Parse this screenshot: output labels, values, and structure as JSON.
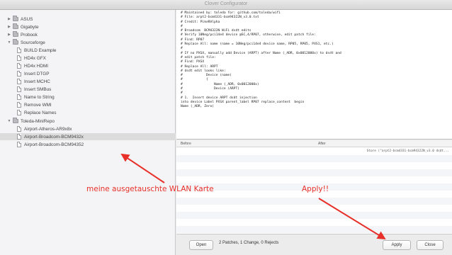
{
  "window": {
    "title": "Clover Configurator"
  },
  "sidebar": {
    "items": [
      {
        "label": "ASUS",
        "type": "folder",
        "expanded": false
      },
      {
        "label": "Gigabyte",
        "type": "folder",
        "expanded": false
      },
      {
        "label": "Probook",
        "type": "folder",
        "expanded": false
      },
      {
        "label": "Sourceforge",
        "type": "folder",
        "expanded": true
      },
      {
        "label": "BUILD Example",
        "type": "file"
      },
      {
        "label": "HD4x GFX",
        "type": "file"
      },
      {
        "label": "HD4x HDMI",
        "type": "file"
      },
      {
        "label": "Insert DTGP",
        "type": "file"
      },
      {
        "label": "Insert MCHC",
        "type": "file"
      },
      {
        "label": "Insert SMBus",
        "type": "file"
      },
      {
        "label": "Name to String",
        "type": "file"
      },
      {
        "label": "Remove WMI",
        "type": "file"
      },
      {
        "label": "Replace Names",
        "type": "file"
      },
      {
        "label": "Toleda-MiniRepo",
        "type": "folder",
        "expanded": true
      },
      {
        "label": "Airport-Atheros-AR9x8x",
        "type": "file"
      },
      {
        "label": "Airport-Broadcom-BCM9432x",
        "type": "file",
        "selected": true
      },
      {
        "label": "Airport-Broadcom-BCM94352",
        "type": "file"
      }
    ]
  },
  "code": {
    "lines": [
      "# Maintained by: toleda for: github.com/toleda/wifi",
      "# File: arpt2-bcm4331-bcm94322N_v3.0.txt",
      "# Credit: PikeRAlpha",
      "#",
      "# Broadcom  BCM4322N WiFi dsdt edits",
      "# Verify 10Neg/pci14e4 device @SC,4/RP07, otherwise, edit patch file:",
      "# Find: RP07",
      "# Replace All: name (name = 10Neg/pci14e4 device name, RP05, RP05, PXS1, etc.)",
      "#",
      "# If no PXSX, manually add Device (ARPT) after Name (_ADR, 0x0012000x) to dsdt and",
      "# edit patch file:",
      "# Find: PXSX",
      "# Replace All: ARPT",
      "# dsdt edit looks like:",
      "#            Device (name)",
      "#            {",
      "#                Name (_ADR, 0x0012000x)",
      "#                Device (ARPT)",
      "#",
      "# 1.  Insert device ARPT dsdt injection",
      "into device Label PXSX parent_label RP07 replace_content  begin",
      "Name (_ADR, Zero)"
    ]
  },
  "diff": {
    "headers": {
      "before": "Before",
      "after": "After"
    },
    "rows": [
      {
        "before": "",
        "after": "Store (\"arpt2-bcm4331-bcm94322N_v3.0 dsdt..."
      }
    ]
  },
  "bottombar": {
    "open_label": "Open",
    "status": "2 Patches, 1 Change, 0 Rejects",
    "apply_label": "Apply",
    "close_label": "Close"
  },
  "annotations": {
    "wlan_note": "meine ausgetauschte WLAN Karte",
    "apply_note": "Apply!!",
    "color": "#e8302a"
  },
  "colors": {
    "sidebar_bg": "#f4f4f6",
    "selection": "#dcdcdc",
    "annotation": "#e8302a"
  }
}
